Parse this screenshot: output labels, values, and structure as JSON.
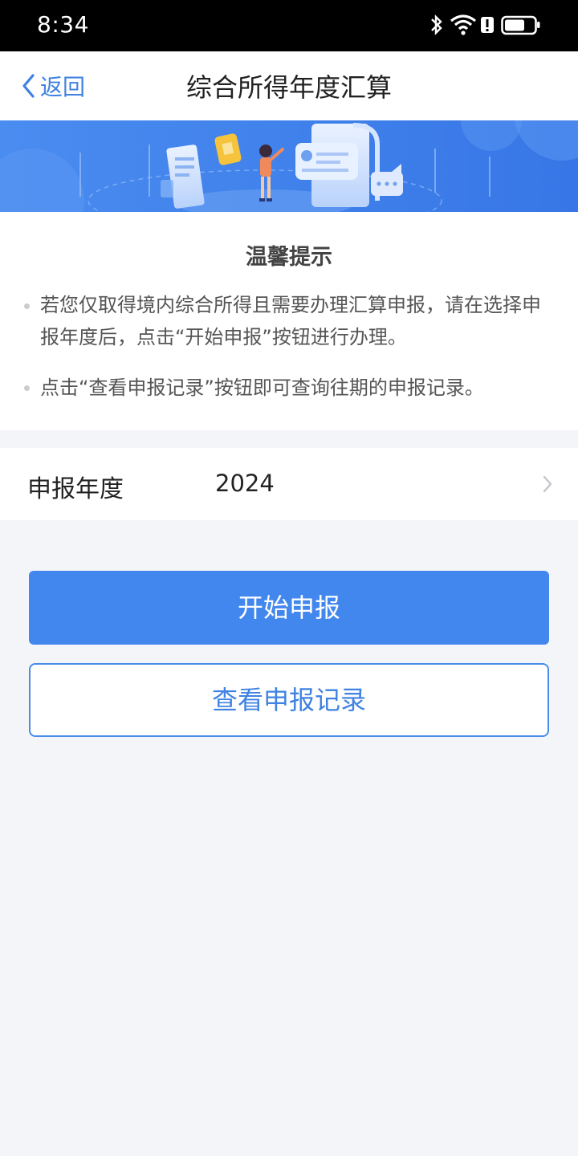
{
  "status_bar": {
    "time": "8:34",
    "icons": [
      "bluetooth-icon",
      "wifi-icon",
      "alert-icon",
      "battery-icon"
    ]
  },
  "nav": {
    "back_label": "返回",
    "title": "综合所得年度汇算"
  },
  "tips": {
    "title": "温馨提示",
    "items": [
      "若您仅取得境内综合所得且需要办理汇算申报，请在选择申报年度后，点击“开始申报”按钮进行办理。",
      "点击“查看申报记录”按钮即可查询往期的申报记录。"
    ]
  },
  "year_selector": {
    "label": "申报年度",
    "value": "2024"
  },
  "actions": {
    "start_label": "开始申报",
    "records_label": "查看申报记录"
  },
  "colors": {
    "accent": "#4287ee",
    "banner_blue": "#3d7fe9",
    "background": "#f3f5f9"
  }
}
